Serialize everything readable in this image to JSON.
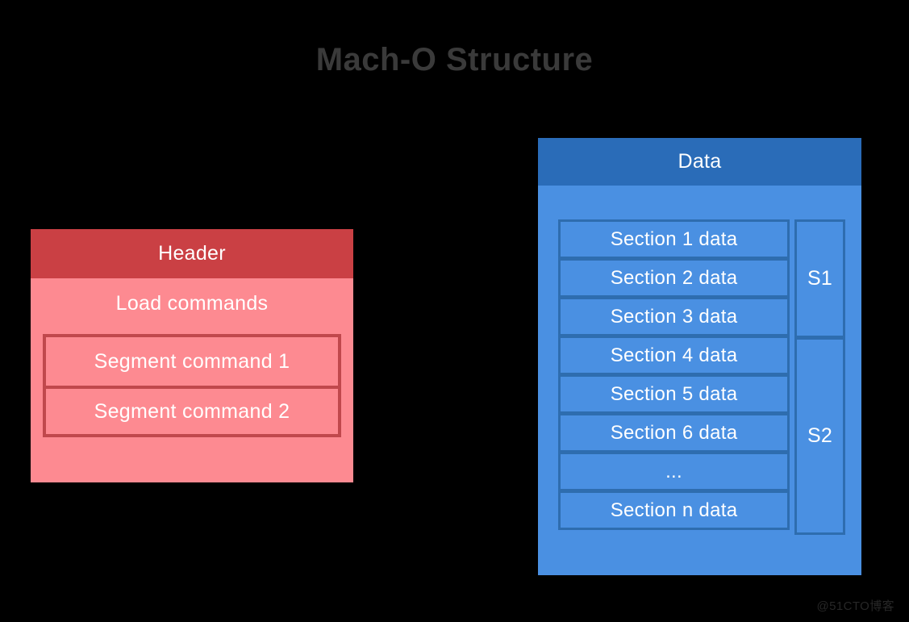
{
  "page": {
    "title": "Mach-O Structure",
    "background_color": "#000000",
    "title_color": "#3a3a3a",
    "watermark": "@51CTO博客"
  },
  "colors": {
    "header_bar_red": "#ca4044",
    "body_pink": "#fd8a91",
    "segment_border_red": "#c0484c",
    "data_bar_blue": "#2a6cb8",
    "body_blue": "#4a90e2",
    "section_border_blue": "#2e6daf",
    "text_white": "#ffffff"
  },
  "macho_header_block": {
    "title": "Header",
    "load_commands_label": "Load commands",
    "segment_commands": [
      {
        "label": "Segment command 1"
      },
      {
        "label": "Segment command 2"
      }
    ]
  },
  "macho_data_block": {
    "title": "Data",
    "sections": [
      {
        "label": "Section 1 data"
      },
      {
        "label": "Section 2 data"
      },
      {
        "label": "Section 3 data"
      },
      {
        "label": "Section 4 data"
      },
      {
        "label": "Section 5 data"
      },
      {
        "label": "Section 6 data"
      },
      {
        "label": "..."
      },
      {
        "label": "Section n data"
      }
    ],
    "segments": [
      {
        "label": "S1",
        "span": 3
      },
      {
        "label": "S2",
        "span": 5
      }
    ]
  }
}
